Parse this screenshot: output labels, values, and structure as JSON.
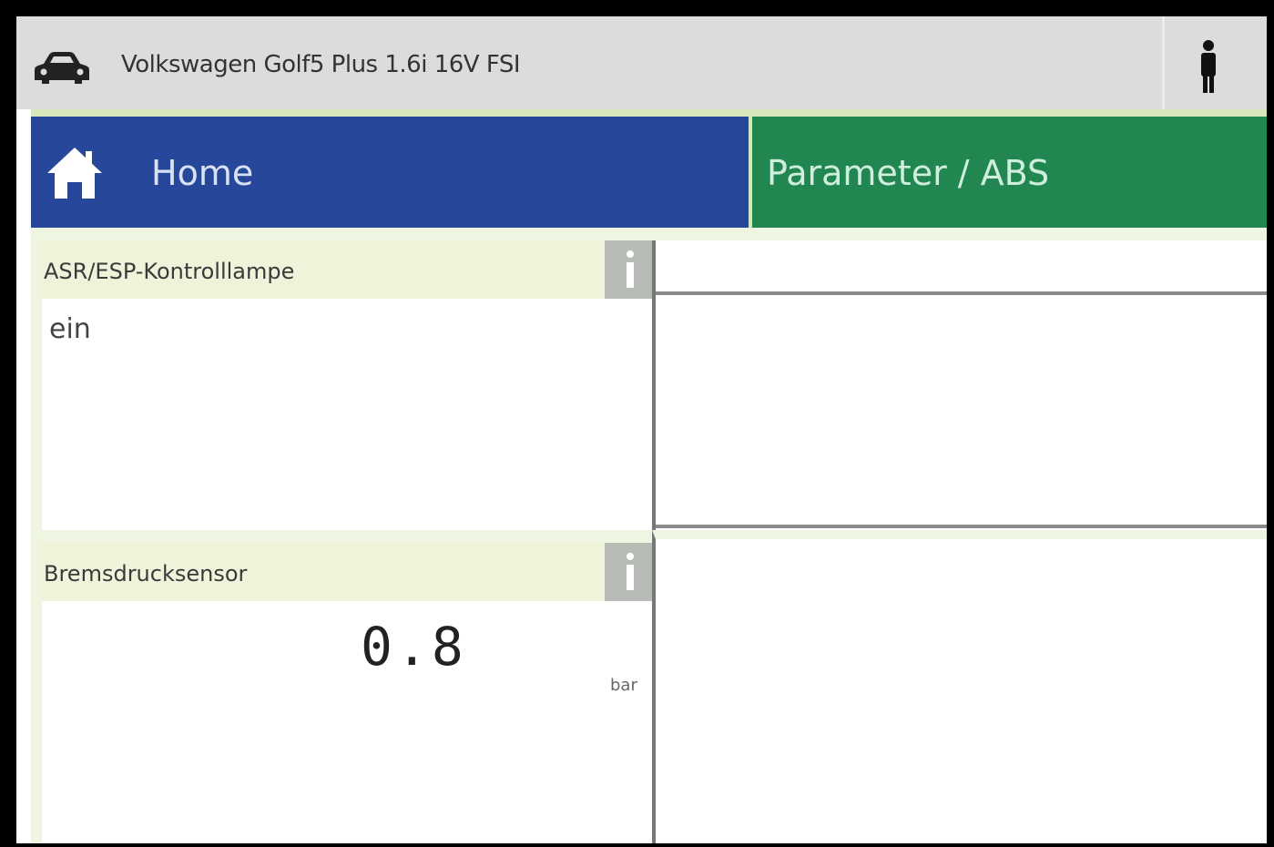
{
  "titlebar": {
    "vehicle": "Volkswagen Golf5 Plus 1.6i 16V FSI",
    "car_icon": "car-icon",
    "user_icon": "person-icon"
  },
  "tabs": {
    "home": {
      "label": "Home",
      "icon": "home-icon",
      "color": "#27489a"
    },
    "section": {
      "label": "Parameter / ABS",
      "color": "#21864f"
    }
  },
  "panels": [
    {
      "title": "ASR/ESP-Kontrolllampe",
      "value": "ein",
      "unit": ""
    },
    {
      "title": "Bremsdrucksensor",
      "value": "0.8",
      "unit": "bar"
    }
  ]
}
